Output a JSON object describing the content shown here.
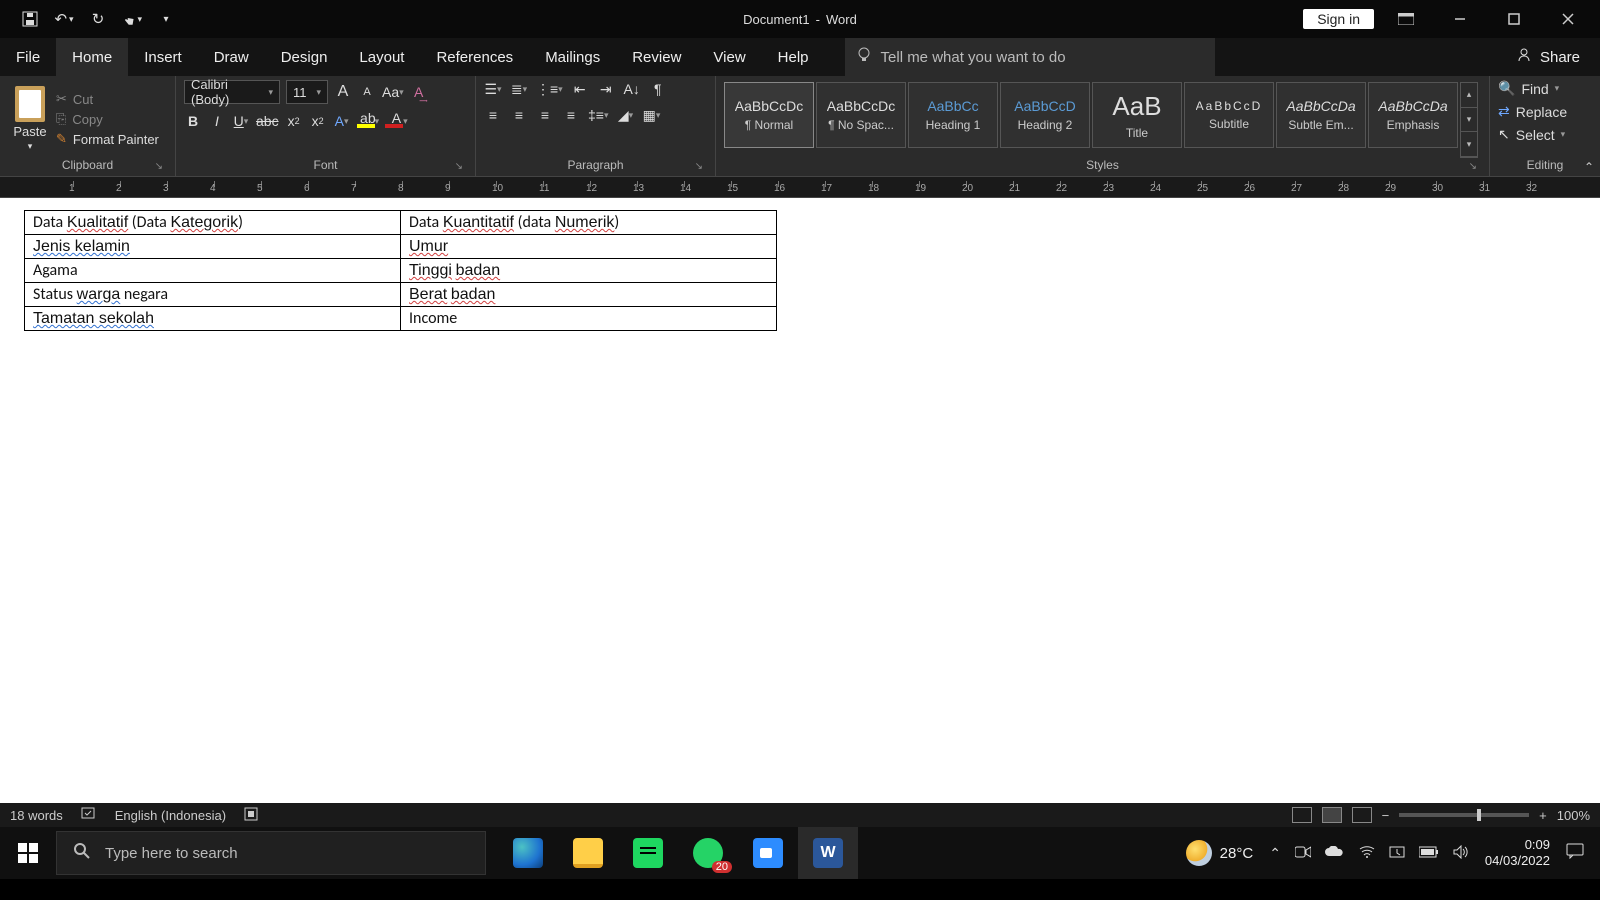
{
  "title": {
    "doc": "Document1",
    "sep": "-",
    "app": "Word",
    "signin": "Sign in"
  },
  "menu": {
    "file": "File",
    "tabs": [
      "Home",
      "Insert",
      "Draw",
      "Design",
      "Layout",
      "References",
      "Mailings",
      "Review",
      "View",
      "Help"
    ],
    "active": "Home",
    "tellme_placeholder": "Tell me what you want to do",
    "share": "Share"
  },
  "clipboard": {
    "paste": "Paste",
    "cut": "Cut",
    "copy": "Copy",
    "painter": "Format Painter",
    "label": "Clipboard"
  },
  "font": {
    "name": "Calibri (Body)",
    "size": "11",
    "label": "Font"
  },
  "paragraph": {
    "label": "Paragraph"
  },
  "styles": {
    "label": "Styles",
    "items": [
      {
        "preview": "AaBbCcDc",
        "name": "¶ Normal",
        "cls": ""
      },
      {
        "preview": "AaBbCcDc",
        "name": "¶ No Spac...",
        "cls": ""
      },
      {
        "preview": "AaBbCc",
        "name": "Heading 1",
        "cls": "blue"
      },
      {
        "preview": "AaBbCcD",
        "name": "Heading 2",
        "cls": "blue"
      },
      {
        "preview": "AaB",
        "name": "Title",
        "cls": "lg"
      },
      {
        "preview": "AaBbCcD",
        "name": "Subtitle",
        "cls": "sp"
      },
      {
        "preview": "AaBbCcDa",
        "name": "Subtle Em...",
        "cls": "it"
      },
      {
        "preview": "AaBbCcDa",
        "name": "Emphasis",
        "cls": "it"
      }
    ]
  },
  "editing": {
    "find": "Find",
    "replace": "Replace",
    "select": "Select",
    "label": "Editing"
  },
  "ruler_numbers": [
    1,
    2,
    3,
    4,
    5,
    6,
    7,
    8,
    9,
    10,
    11,
    12,
    13,
    14,
    15,
    16,
    17,
    18,
    19,
    20,
    21,
    22,
    23,
    24,
    25,
    26,
    27,
    28,
    29,
    30,
    31,
    32
  ],
  "table": {
    "rows": [
      [
        "Data Kualitatif (Data Kategorik)",
        "Data Kuantitatif (data Numerik)"
      ],
      [
        "Jenis kelamin",
        "Umur"
      ],
      [
        "Agama",
        "Tinggi badan"
      ],
      [
        "Status warga negara",
        "Berat badan"
      ],
      [
        "Tamatan sekolah",
        "Income"
      ]
    ]
  },
  "wstatus": {
    "words": "18 words",
    "lang": "English (Indonesia)",
    "zoom": "100%"
  },
  "taskbar": {
    "search_placeholder": "Type here to search",
    "whats_badge": "20",
    "temp": "28°C",
    "time": "0:09",
    "date": "04/03/2022"
  }
}
